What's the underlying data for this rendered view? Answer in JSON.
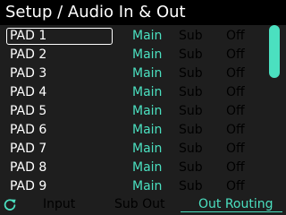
{
  "title": "Setup / Audio In & Out",
  "colors": {
    "accent": "#4be0c0",
    "background": "#000000",
    "panel": "#1e1e1e"
  },
  "list": {
    "selected_index": 0,
    "rows": [
      {
        "pad": "PAD 1",
        "main": "Main",
        "sub": "Sub",
        "off": "Off"
      },
      {
        "pad": "PAD 2",
        "main": "Main",
        "sub": "Sub",
        "off": "Off"
      },
      {
        "pad": "PAD 3",
        "main": "Main",
        "sub": "Sub",
        "off": "Off"
      },
      {
        "pad": "PAD 4",
        "main": "Main",
        "sub": "Sub",
        "off": "Off"
      },
      {
        "pad": "PAD 5",
        "main": "Main",
        "sub": "Sub",
        "off": "Off"
      },
      {
        "pad": "PAD 6",
        "main": "Main",
        "sub": "Sub",
        "off": "Off"
      },
      {
        "pad": "PAD 7",
        "main": "Main",
        "sub": "Sub",
        "off": "Off"
      },
      {
        "pad": "PAD 8",
        "main": "Main",
        "sub": "Sub",
        "off": "Off"
      },
      {
        "pad": "PAD 9",
        "main": "Main",
        "sub": "Sub",
        "off": "Off"
      }
    ]
  },
  "footer": {
    "reload_icon": "reload-icon",
    "tabs": [
      "Input",
      "Sub Out",
      "Out Routing"
    ],
    "active_tab": "Out Routing"
  }
}
